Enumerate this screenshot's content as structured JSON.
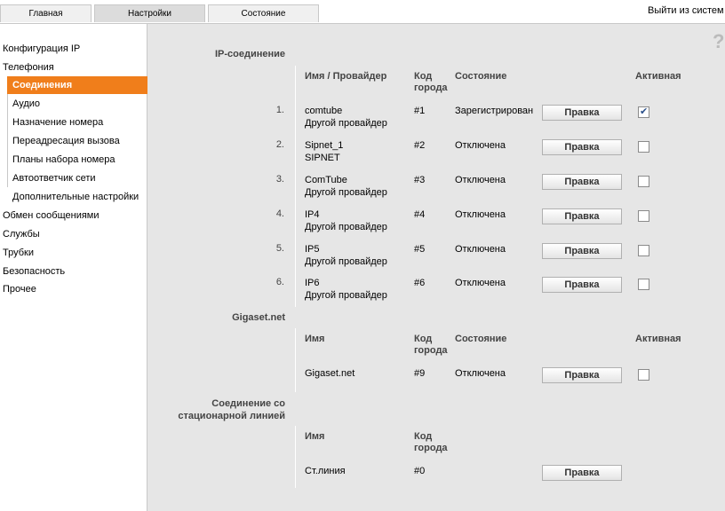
{
  "tabs": [
    {
      "label": "Главная",
      "active": false
    },
    {
      "label": "Настройки",
      "active": true
    },
    {
      "label": "Состояние",
      "active": false
    }
  ],
  "logout_label": "Выйти из систем",
  "help_icon": "?",
  "sidebar": {
    "items": [
      {
        "label": "Конфигурация IP",
        "level": "top"
      },
      {
        "label": "Телефония",
        "level": "top"
      },
      {
        "label": "Соединения",
        "level": "sub",
        "selected": true
      },
      {
        "label": "Аудио",
        "level": "sub"
      },
      {
        "label": "Назначение номера",
        "level": "sub"
      },
      {
        "label": "Переадресация вызова",
        "level": "sub"
      },
      {
        "label": "Планы набора номера",
        "level": "sub"
      },
      {
        "label": "Автоответчик сети",
        "level": "sub"
      },
      {
        "label": "Дополнительные настройки",
        "level": "sub"
      },
      {
        "label": "Обмен сообщениями",
        "level": "top"
      },
      {
        "label": "Службы",
        "level": "top"
      },
      {
        "label": "Трубки",
        "level": "top"
      },
      {
        "label": "Безопасность",
        "level": "top"
      },
      {
        "label": "Прочее",
        "level": "top"
      }
    ]
  },
  "ip_section": {
    "title": "IP-соединение",
    "headers": {
      "name": "Имя / Провайдер",
      "code": "Код города",
      "status": "Состояние",
      "active": "Активная"
    },
    "rows": [
      {
        "num": "1.",
        "name": "comtube",
        "provider": "Другой провайдер",
        "code": "#1",
        "status": "Зарегистрирован",
        "button": "Правка",
        "active": true
      },
      {
        "num": "2.",
        "name": "Sipnet_1",
        "provider": "SIPNET",
        "code": "#2",
        "status": "Отключена",
        "button": "Правка",
        "active": false
      },
      {
        "num": "3.",
        "name": "ComTube",
        "provider": "Другой провайдер",
        "code": "#3",
        "status": "Отключена",
        "button": "Правка",
        "active": false
      },
      {
        "num": "4.",
        "name": "IP4",
        "provider": "Другой провайдер",
        "code": "#4",
        "status": "Отключена",
        "button": "Правка",
        "active": false
      },
      {
        "num": "5.",
        "name": "IP5",
        "provider": "Другой провайдер",
        "code": "#5",
        "status": "Отключена",
        "button": "Правка",
        "active": false
      },
      {
        "num": "6.",
        "name": "IP6",
        "provider": "Другой провайдер",
        "code": "#6",
        "status": "Отключена",
        "button": "Правка",
        "active": false
      }
    ]
  },
  "gigaset_section": {
    "title": "Gigaset.net",
    "headers": {
      "name": "Имя",
      "code": "Код города",
      "status": "Состояние",
      "active": "Активная"
    },
    "row": {
      "name": "Gigaset.net",
      "code": "#9",
      "status": "Отключена",
      "button": "Правка",
      "active": false
    }
  },
  "landline_section": {
    "title_line1": "Соединение со",
    "title_line2": "стационарной линией",
    "headers": {
      "name": "Имя",
      "code": "Код города"
    },
    "row": {
      "name": "Ст.линия",
      "code": "#0",
      "button": "Правка"
    }
  }
}
